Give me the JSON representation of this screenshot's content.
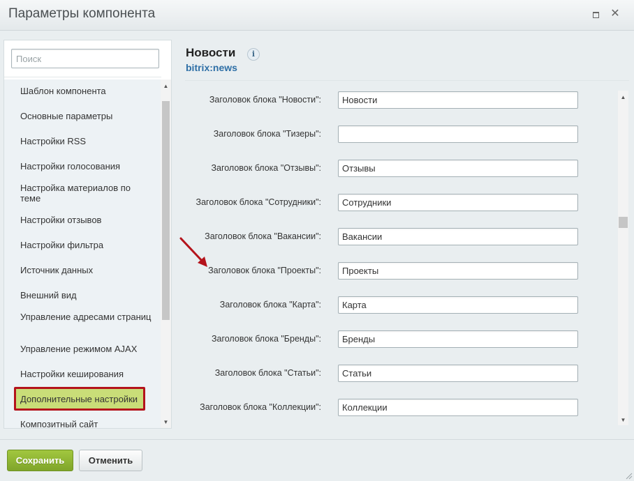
{
  "window": {
    "title": "Параметры компонента"
  },
  "sidebar": {
    "search_placeholder": "Поиск",
    "items": [
      {
        "label": "Шаблон компонента"
      },
      {
        "label": "Основные параметры"
      },
      {
        "label": "Настройки RSS"
      },
      {
        "label": "Настройки голосования"
      },
      {
        "label": "Настройка материалов по теме"
      },
      {
        "label": "Настройки отзывов"
      },
      {
        "label": "Настройки фильтра"
      },
      {
        "label": "Источник данных"
      },
      {
        "label": "Внешний вид"
      },
      {
        "label": "Управление адресами страниц"
      },
      {
        "label": "Управление режимом AJAX"
      },
      {
        "label": "Настройки кеширования"
      },
      {
        "label": "Дополнительные настройки"
      },
      {
        "label": "Композитный сайт"
      }
    ],
    "active_item": "Дополнительные настройки"
  },
  "panel": {
    "title": "Новости",
    "subtitle": "bitrix:news",
    "info_icon": "info-icon",
    "fields": [
      {
        "label": "Заголовок блока \"Новости\":",
        "value": "Новости"
      },
      {
        "label": "Заголовок блока \"Тизеры\":",
        "value": ""
      },
      {
        "label": "Заголовок блока \"Отзывы\":",
        "value": "Отзывы"
      },
      {
        "label": "Заголовок блока \"Сотрудники\":",
        "value": "Сотрудники"
      },
      {
        "label": "Заголовок блока \"Вакансии\":",
        "value": "Вакансии"
      },
      {
        "label": "Заголовок блока \"Проекты\":",
        "value": "Проекты"
      },
      {
        "label": "Заголовок блока \"Карта\":",
        "value": "Карта"
      },
      {
        "label": "Заголовок блока \"Бренды\":",
        "value": "Бренды"
      },
      {
        "label": "Заголовок блока \"Статьи\":",
        "value": "Статьи"
      },
      {
        "label": "Заголовок блока \"Коллекции\":",
        "value": "Коллекции"
      }
    ]
  },
  "footer": {
    "save_label": "Сохранить",
    "cancel_label": "Отменить"
  },
  "colors": {
    "save_button": "#8db533",
    "active_item_bg": "#c9dd78",
    "highlight_border": "#b4131b",
    "subtitle_link": "#2e6fa6"
  }
}
